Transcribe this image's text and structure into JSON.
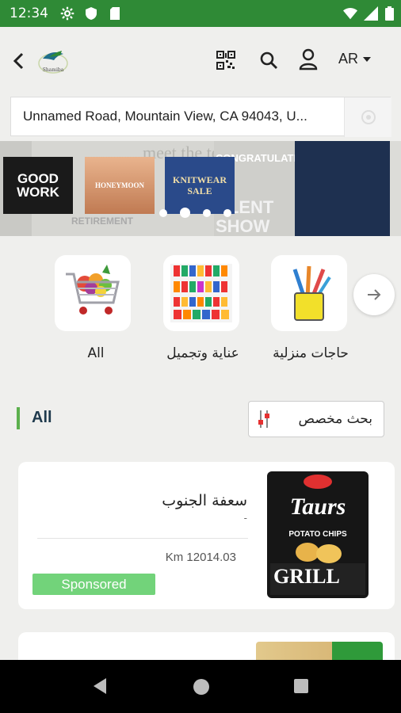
{
  "status": {
    "time": "12:34"
  },
  "header": {
    "language": "AR"
  },
  "address": {
    "text": "Unnamed Road, Mountain View, CA 94043, U..."
  },
  "banner": {
    "thumbs": [
      {
        "text": "GOOD WORK"
      },
      {
        "text": "HONEYMOON"
      },
      {
        "text": "KNITWEAR SALE"
      }
    ],
    "bg_texts": [
      "CONGRATULATIO",
      "ALENT SHOW",
      "RETIREMENT",
      "meet the teacher"
    ]
  },
  "categories": [
    {
      "label": "All"
    },
    {
      "label": "عناية وتجميل"
    },
    {
      "label": "حاجات منزلية"
    }
  ],
  "section": {
    "title": "All",
    "filter_label": "بحث مخصص"
  },
  "store": {
    "name": "سعفة الجنوب",
    "sub": "-",
    "distance": "Km 12014.03",
    "badge": "Sponsored"
  },
  "product": {
    "brand": "Taurs",
    "line1": "POTATO CHIPS",
    "flavor": "GRILL"
  },
  "colors": {
    "status_bar": "#2f8a36",
    "accent_green": "#5cb04d",
    "sponsored": "#72d37a"
  }
}
